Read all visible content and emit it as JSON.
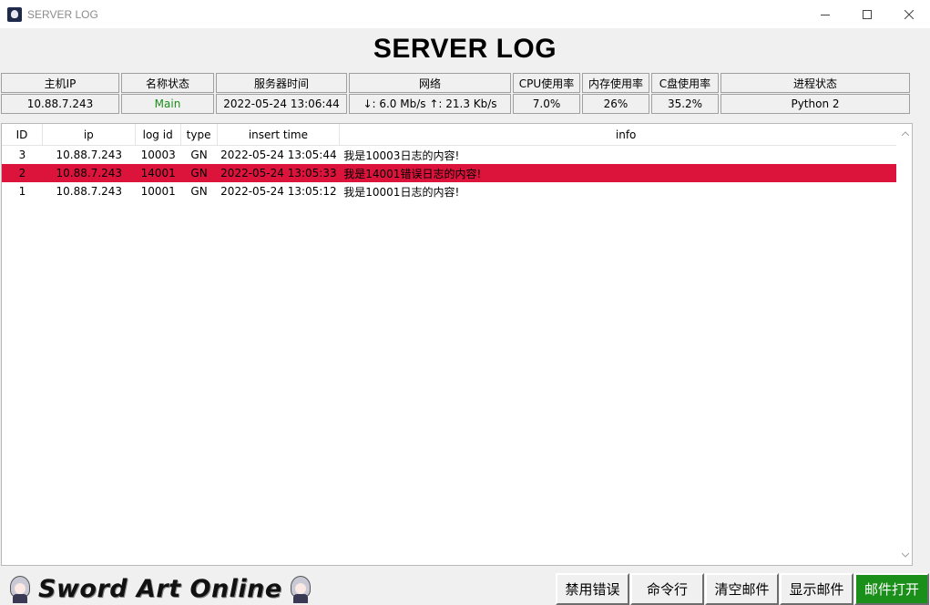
{
  "window": {
    "title": "SERVER LOG"
  },
  "page_title": "SERVER LOG",
  "status_table": {
    "headers": [
      "主机IP",
      "名称状态",
      "服务器时间",
      "网络",
      "CPU使用率",
      "内存使用率",
      "C盘使用率",
      "进程状态"
    ],
    "values": [
      "10.88.7.243",
      "Main",
      "2022-05-24 13:06:44",
      "↓: 6.0 Mb/s ↑: 21.3 Kb/s",
      "7.0%",
      "26%",
      "35.2%",
      "Python 2"
    ],
    "name_status_color": "#1a8f1a"
  },
  "log_table": {
    "columns": [
      "ID",
      "ip",
      "log id",
      "type",
      "insert time",
      "info"
    ],
    "rows": [
      {
        "id": "3",
        "ip": "10.88.7.243",
        "log_id": "10003",
        "type": "GN",
        "insert_time": "2022-05-24 13:05:44",
        "info": "我是10003日志的内容!"
      },
      {
        "id": "2",
        "ip": "10.88.7.243",
        "log_id": "14001",
        "type": "GN",
        "insert_time": "2022-05-24 13:05:33",
        "info": "我是14001错误日志的内容!"
      },
      {
        "id": "1",
        "ip": "10.88.7.243",
        "log_id": "10001",
        "type": "GN",
        "insert_time": "2022-05-24 13:05:12",
        "info": "我是10001日志的内容!"
      }
    ],
    "error_row_color": "#dc143c"
  },
  "footer": {
    "logo_text": "Sword Art Online",
    "buttons": [
      "禁用错误",
      "命令行",
      "清空邮件",
      "显示邮件",
      "邮件打开"
    ],
    "active_button_color": "#1a8f1a"
  }
}
